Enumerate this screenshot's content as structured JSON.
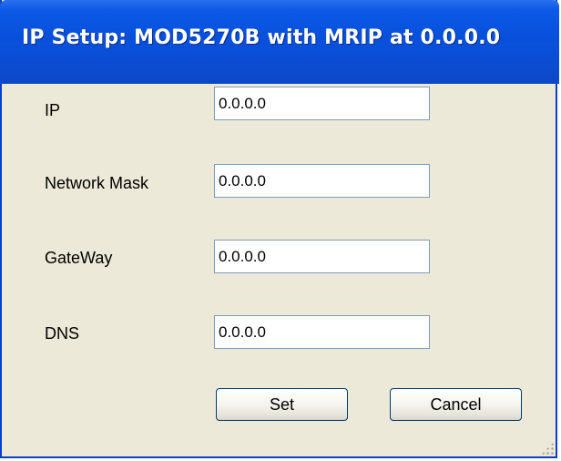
{
  "window": {
    "title": "IP Setup: MOD5270B with MRIP at 0.0.0.0"
  },
  "fields": [
    {
      "label": "IP",
      "value": "0.0.0.0"
    },
    {
      "label": "Network Mask",
      "value": "0.0.0.0"
    },
    {
      "label": "GateWay",
      "value": "0.0.0.0"
    },
    {
      "label": "DNS",
      "value": "0.0.0.0"
    }
  ],
  "buttons": {
    "set_label": "Set",
    "cancel_label": "Cancel"
  },
  "colors": {
    "titlebar": "#0a4ed6",
    "dialog_face": "#ece9d8",
    "input_border": "#7f9db9"
  }
}
